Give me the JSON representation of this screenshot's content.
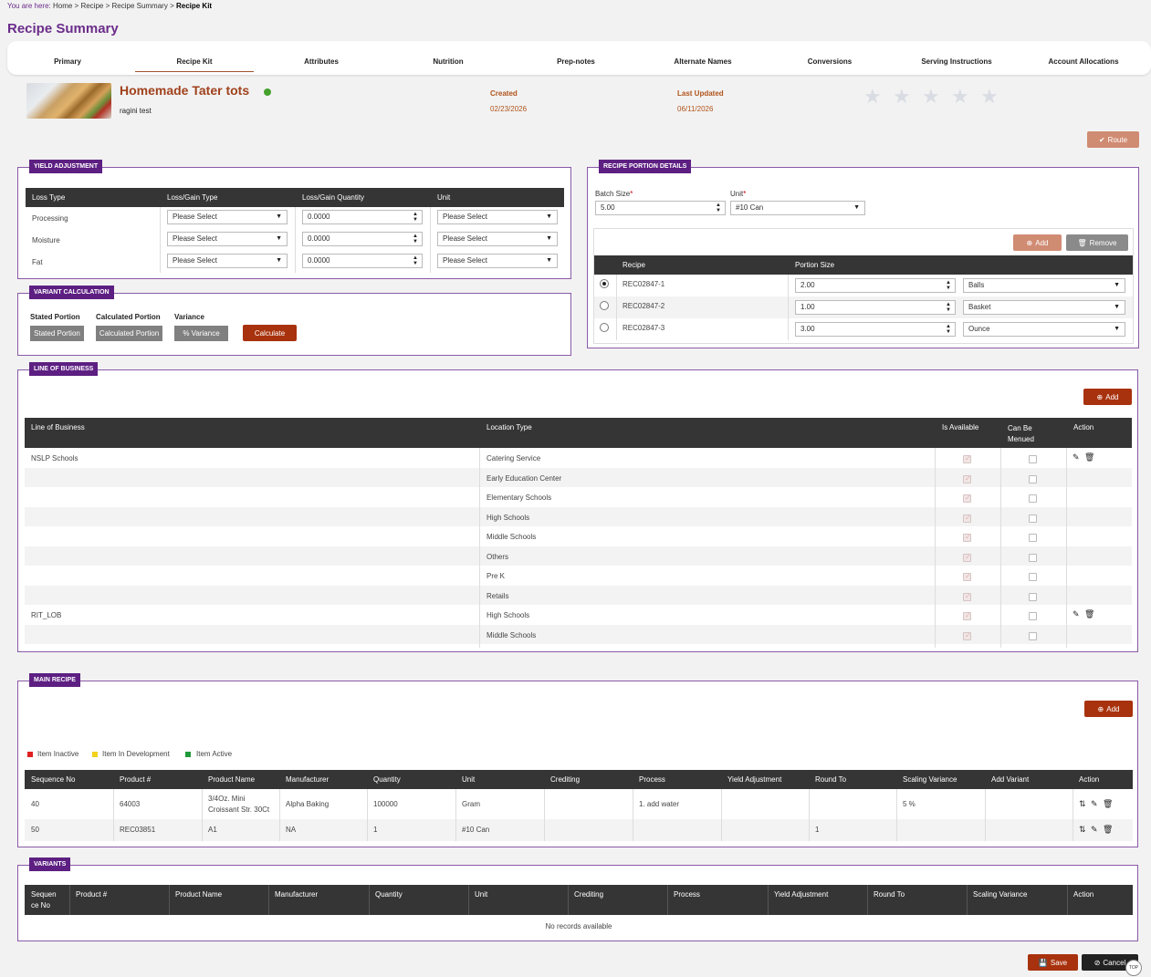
{
  "breadcrumb": {
    "label": "You are here:",
    "items": [
      "Home",
      "Recipe",
      "Recipe Summary"
    ],
    "current": "Recipe Kit"
  },
  "page_title": "Recipe Summary",
  "tabs": [
    "Primary",
    "Recipe Kit",
    "Attributes",
    "Nutrition",
    "Prep-notes",
    "Alternate Names",
    "Conversions",
    "Serving Instructions",
    "Account Allocations"
  ],
  "active_tab": "Recipe Kit",
  "recipe": {
    "name": "Homemade Tater tots",
    "status_color": "#45a02d",
    "sub": "ragini test",
    "created_label": "Created",
    "created": "02/23/2026",
    "updated_label": "Last Updated",
    "updated": "06/11/2026",
    "rating": 0,
    "stars": 5
  },
  "route_btn": "Route",
  "yield": {
    "title": "YIELD ADJUSTMENT",
    "headers": [
      "Loss Type",
      "Loss/Gain Type",
      "Loss/Gain Quantity",
      "Unit"
    ],
    "rows": [
      {
        "type": "Processing",
        "gain": "Please Select",
        "qty": "0.0000",
        "unit": "Please Select"
      },
      {
        "type": "Moisture",
        "gain": "Please Select",
        "qty": "0.0000",
        "unit": "Please Select"
      },
      {
        "type": "Fat",
        "gain": "Please Select",
        "qty": "0.0000",
        "unit": "Please Select"
      }
    ]
  },
  "variant_calc": {
    "title": "VARIANT CALCULATION",
    "labels": [
      "Stated Portion",
      "Calculated Portion",
      "Variance"
    ],
    "values": [
      "Stated Portion",
      "Calculated Portion",
      "% Variance"
    ],
    "button": "Calculate"
  },
  "portion": {
    "title": "RECIPE PORTION DETAILS",
    "batch_label": "Batch Size",
    "batch_value": "5.00",
    "unit_label": "Unit",
    "unit_value": "#10 Can",
    "add": "Add",
    "remove": "Remove",
    "headers": [
      "Recipe",
      "Portion Size"
    ],
    "rows": [
      {
        "recipe": "REC02847-1",
        "size": "2.00",
        "unit": "Balls",
        "selected": true
      },
      {
        "recipe": "REC02847-2",
        "size": "1.00",
        "unit": "Basket",
        "selected": false
      },
      {
        "recipe": "REC02847-3",
        "size": "3.00",
        "unit": "Ounce",
        "selected": false
      }
    ]
  },
  "lob": {
    "title": "LINE OF BUSINESS",
    "add": "Add",
    "headers": [
      "Line of Business",
      "Location Type",
      "Is Available",
      "Can Be Menued",
      "Action"
    ],
    "rows": [
      {
        "lob": "NSLP Schools",
        "loc": "Catering Service",
        "avail": true,
        "menu": false,
        "actions": true
      },
      {
        "lob": "",
        "loc": "Early Education Center",
        "avail": true,
        "menu": false,
        "actions": false
      },
      {
        "lob": "",
        "loc": "Elementary Schools",
        "avail": true,
        "menu": false,
        "actions": false
      },
      {
        "lob": "",
        "loc": "High Schools",
        "avail": true,
        "menu": false,
        "actions": false
      },
      {
        "lob": "",
        "loc": "Middle Schools",
        "avail": true,
        "menu": false,
        "actions": false
      },
      {
        "lob": "",
        "loc": "Others",
        "avail": true,
        "menu": false,
        "actions": false
      },
      {
        "lob": "",
        "loc": "Pre K",
        "avail": true,
        "menu": false,
        "actions": false
      },
      {
        "lob": "",
        "loc": "Retails",
        "avail": true,
        "menu": false,
        "actions": false
      },
      {
        "lob": "RIT_LOB",
        "loc": "High Schools",
        "avail": true,
        "menu": false,
        "actions": true
      },
      {
        "lob": "",
        "loc": "Middle Schools",
        "avail": true,
        "menu": false,
        "actions": false
      }
    ]
  },
  "main_recipe": {
    "title": "MAIN RECIPE",
    "add": "Add",
    "legend": [
      {
        "label": "Item Inactive",
        "color": "#e02020"
      },
      {
        "label": "Item In Development",
        "color": "#f2d21b"
      },
      {
        "label": "Item Active",
        "color": "#1f9a3a"
      }
    ],
    "headers": [
      "Sequence No",
      "Product #",
      "Product Name",
      "Manufacturer",
      "Quantity",
      "Unit",
      "Crediting",
      "Process",
      "Yield Adjustment",
      "Round To",
      "Scaling Variance",
      "Add Variant",
      "Action"
    ],
    "rows": [
      {
        "seq": "40",
        "prod": "64003",
        "name1": "3/4Oz. Mini",
        "name2": "Croissant Str. 30Ct",
        "mfr": "Alpha Baking",
        "qty": "100000",
        "unit": "Gram",
        "cred": "",
        "proc": "1. add water",
        "yield": "",
        "round": "",
        "scale": "5 %",
        "addv": ""
      },
      {
        "seq": "50",
        "prod": "REC03851",
        "name1": "A1",
        "name2": "",
        "mfr": "NA",
        "qty": "1",
        "unit": "#10 Can",
        "cred": "",
        "proc": "",
        "yield": "",
        "round": "1",
        "scale": "",
        "addv": ""
      }
    ]
  },
  "variants": {
    "title": "VARIANTS",
    "headers": [
      "Sequen",
      "Product #",
      "Product Name",
      "Manufacturer",
      "Quantity",
      "Unit",
      "Crediting",
      "Process",
      "Yield Adjustment",
      "Round To",
      "Scaling Variance",
      "Action"
    ],
    "header0_line2": "ce No",
    "empty": "No records available"
  },
  "footer": {
    "save": "Save",
    "cancel": "Cancel",
    "top": "TOP"
  }
}
